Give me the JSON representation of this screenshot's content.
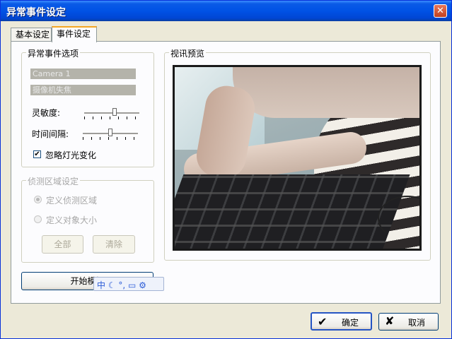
{
  "window": {
    "title": "异常事件设定",
    "close_glyph": "✕"
  },
  "tabs": [
    {
      "label": "基本设定"
    },
    {
      "label": "事件设定"
    }
  ],
  "event_options": {
    "group_title": "异常事件选项",
    "camera_field": "Camera 1",
    "event_type_field": "摄像机失焦",
    "sensitivity_label": "灵敏度:",
    "sensitivity_value": 0.55,
    "interval_label": "时间间隔:",
    "interval_value": 0.5,
    "ignore_light_label": "忽略灯光变化",
    "ignore_light_checked": true,
    "check_glyph": "✔"
  },
  "detect_area": {
    "group_title": "侦测区域设定",
    "define_area_label": "定义侦测区域",
    "define_size_label": "定义对象大小",
    "all_button": "全部",
    "clear_button": "清除"
  },
  "preview": {
    "group_title": "视讯预览"
  },
  "start_sim_button": "开始模拟",
  "footer": {
    "ok_button": "确定",
    "ok_icon": "✔",
    "cancel_button": "取消",
    "cancel_icon": "✘"
  },
  "ime_toolbar": {
    "chars": "中 ☾ °, ▭ ⚙"
  }
}
